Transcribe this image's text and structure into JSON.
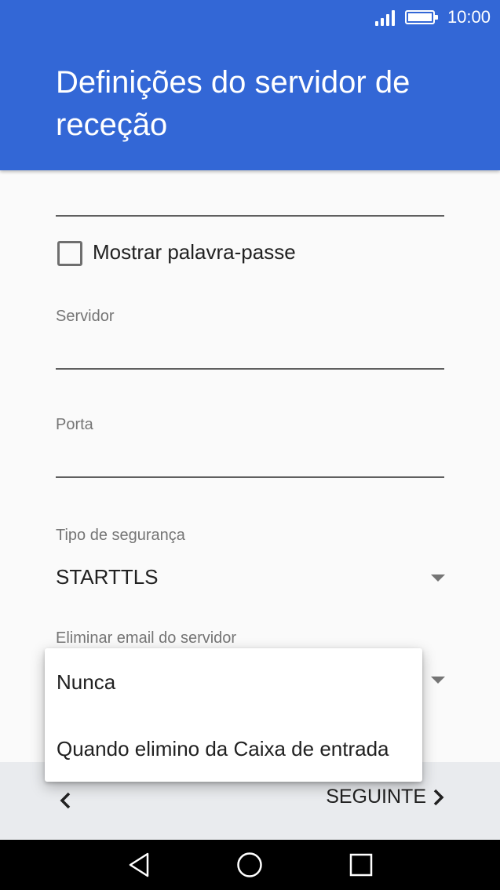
{
  "status_bar": {
    "time": "10:00"
  },
  "header": {
    "title": "Definições do servidor de receção"
  },
  "form": {
    "show_password_label": "Mostrar palavra-passe",
    "server_label": "Servidor",
    "server_value": "",
    "port_label": "Porta",
    "port_value": "",
    "security_type_label": "Tipo de segurança",
    "security_type_value": "STARTTLS",
    "delete_email_label": "Eliminar email do servidor"
  },
  "dropdown": {
    "options": [
      "Nunca",
      "Quando elimino da Caixa de entrada"
    ]
  },
  "bottom_bar": {
    "next_label": "SEGUINTE"
  },
  "icons": {
    "signal": "signal-icon",
    "battery": "battery-icon",
    "back": "chevron-left-icon",
    "next": "chevron-right-icon",
    "nav_back": "triangle-back-icon",
    "nav_home": "circle-home-icon",
    "nav_recents": "square-recents-icon"
  },
  "colors": {
    "header": "#3367d6",
    "background": "#fafafa",
    "bottom_bar": "#e9ebee"
  }
}
